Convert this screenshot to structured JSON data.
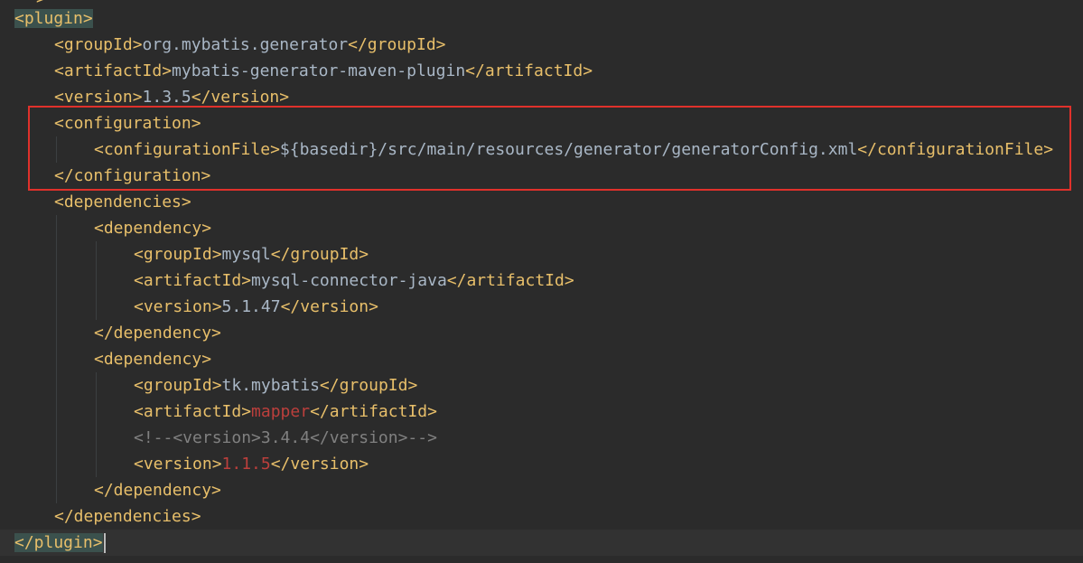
{
  "editor": {
    "top_fragment": ">",
    "lines": [
      {
        "indent": 0,
        "tokens": [
          [
            "hl",
            "<plugin>"
          ]
        ]
      },
      {
        "indent": 1,
        "tokens": [
          [
            "tag",
            "<groupId>"
          ],
          [
            "text",
            "org.mybatis.generator"
          ],
          [
            "tag",
            "</groupId>"
          ]
        ]
      },
      {
        "indent": 1,
        "tokens": [
          [
            "tag",
            "<artifactId>"
          ],
          [
            "text",
            "mybatis-generator-maven-plugin"
          ],
          [
            "tag",
            "</artifactId>"
          ]
        ]
      },
      {
        "indent": 1,
        "tokens": [
          [
            "tag",
            "<version>"
          ],
          [
            "text",
            "1.3.5"
          ],
          [
            "tag",
            "</version>"
          ]
        ]
      },
      {
        "indent": 1,
        "tokens": [
          [
            "tag",
            "<configuration>"
          ]
        ]
      },
      {
        "indent": 2,
        "tokens": [
          [
            "tag",
            "<configurationFile>"
          ],
          [
            "text",
            "${basedir}/src/main/resources/generator/generatorConfig.xml"
          ],
          [
            "tag",
            "</configurationFile>"
          ]
        ]
      },
      {
        "indent": 1,
        "tokens": [
          [
            "tag",
            "</configuration>"
          ]
        ]
      },
      {
        "indent": 1,
        "tokens": [
          [
            "tag",
            "<dependencies>"
          ]
        ]
      },
      {
        "indent": 2,
        "tokens": [
          [
            "tag",
            "<dependency>"
          ]
        ]
      },
      {
        "indent": 3,
        "tokens": [
          [
            "tag",
            "<groupId>"
          ],
          [
            "text",
            "mysql"
          ],
          [
            "tag",
            "</groupId>"
          ]
        ]
      },
      {
        "indent": 3,
        "tokens": [
          [
            "tag",
            "<artifactId>"
          ],
          [
            "text",
            "mysql-connector-java"
          ],
          [
            "tag",
            "</artifactId>"
          ]
        ]
      },
      {
        "indent": 3,
        "tokens": [
          [
            "tag",
            "<version>"
          ],
          [
            "text",
            "5.1.47"
          ],
          [
            "tag",
            "</version>"
          ]
        ]
      },
      {
        "indent": 2,
        "tokens": [
          [
            "tag",
            "</dependency>"
          ]
        ]
      },
      {
        "indent": 2,
        "tokens": [
          [
            "tag",
            "<dependency>"
          ]
        ]
      },
      {
        "indent": 3,
        "tokens": [
          [
            "tag",
            "<groupId>"
          ],
          [
            "text",
            "tk.mybatis"
          ],
          [
            "tag",
            "</groupId>"
          ]
        ]
      },
      {
        "indent": 3,
        "tokens": [
          [
            "tag",
            "<artifactId>"
          ],
          [
            "err",
            "mapper"
          ],
          [
            "tag",
            "</artifactId>"
          ]
        ]
      },
      {
        "indent": 3,
        "tokens": [
          [
            "comment",
            "<!--<version>3.4.4</version>-->"
          ]
        ]
      },
      {
        "indent": 3,
        "tokens": [
          [
            "tag",
            "<version>"
          ],
          [
            "err",
            "1.1.5"
          ],
          [
            "tag",
            "</version>"
          ]
        ]
      },
      {
        "indent": 2,
        "tokens": [
          [
            "tag",
            "</dependency>"
          ]
        ]
      },
      {
        "indent": 1,
        "tokens": [
          [
            "tag",
            "</dependencies>"
          ]
        ]
      },
      {
        "indent": 0,
        "tokens": [
          [
            "hl",
            "</plugin>"
          ]
        ],
        "current": true
      }
    ]
  },
  "annotation": {
    "color": "#e0312b"
  },
  "colors": {
    "background": "#2b2b2b",
    "tag": "#e8bf6a",
    "text": "#a9b7c6",
    "comment": "#808080",
    "error": "#bc3f3c"
  }
}
